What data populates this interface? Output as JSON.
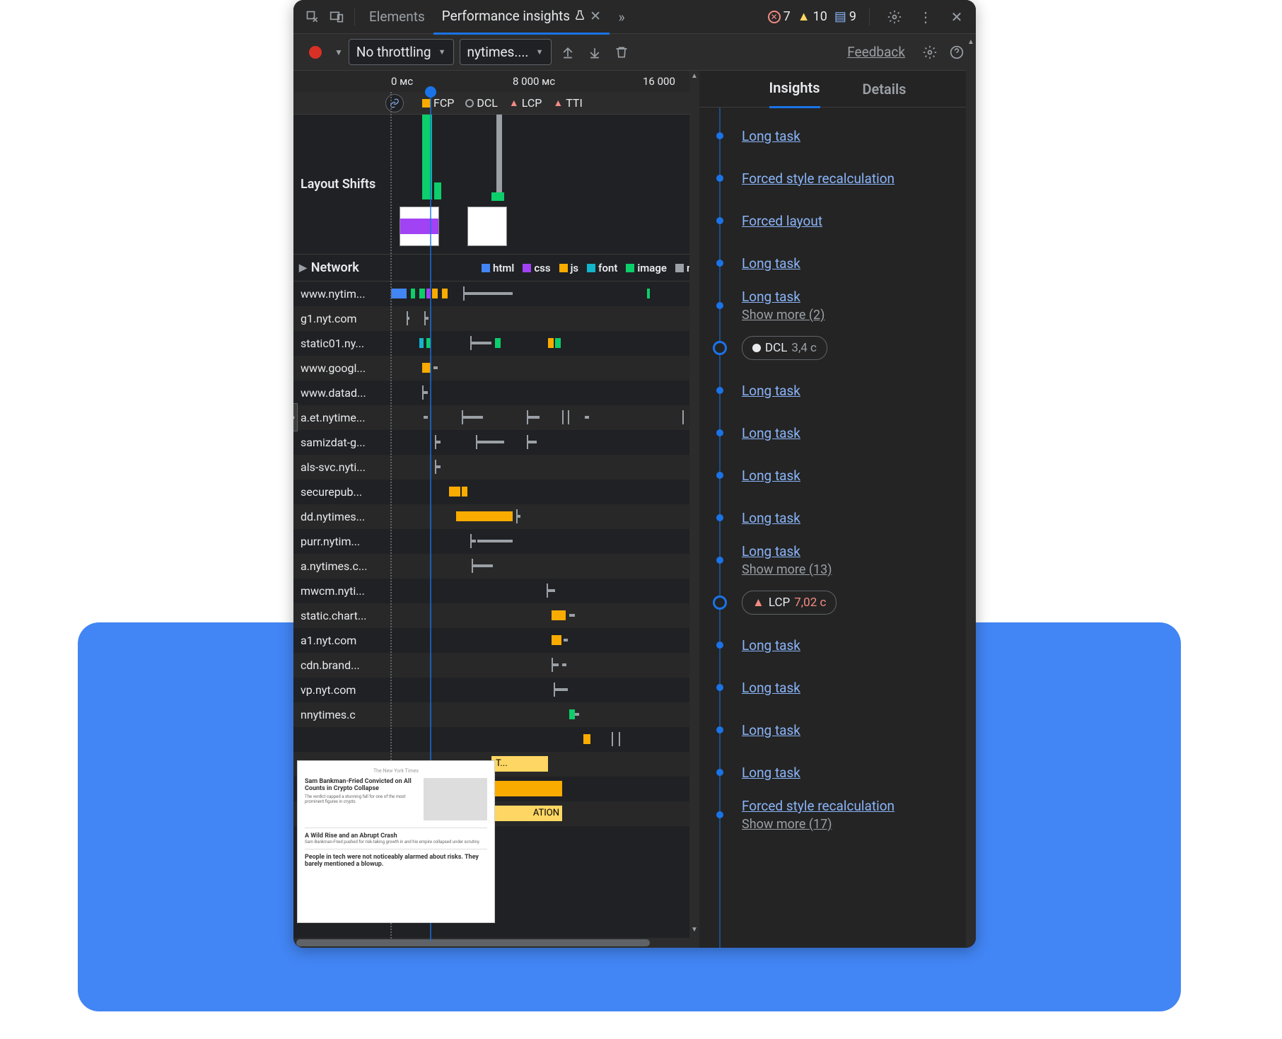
{
  "toolbar": {
    "tabs": {
      "elements": "Elements",
      "perf_insights": "Performance insights"
    },
    "status": {
      "errors": "7",
      "warnings": "10",
      "messages": "9"
    }
  },
  "action_bar": {
    "throttling": "No throttling",
    "target": "nytimes....",
    "feedback": "Feedback"
  },
  "timeline": {
    "ticks": {
      "t0": "0 мс",
      "t8000": "8 000 мс",
      "t16000": "16 000"
    },
    "metrics": {
      "fcp": "FCP",
      "dcl": "DCL",
      "lcp": "LCP",
      "tti": "TTI"
    }
  },
  "layout_shifts": {
    "label": "Layout Shifts"
  },
  "network": {
    "header": "Network",
    "legend": {
      "html": "html",
      "css": "css",
      "js": "js",
      "font": "font",
      "image": "image",
      "m": "m"
    },
    "colors": {
      "html": "#4285f4",
      "css": "#a142f4",
      "js": "#f9ab00",
      "font": "#12b5cb",
      "image": "#0cce6b"
    },
    "rows": [
      "www.nytim...",
      "g1.nyt.com",
      "static01.ny...",
      "www.googl...",
      "www.datad...",
      "a.et.nytime...",
      "samizdat-g...",
      "als-svc.nyti...",
      "securepub...",
      "dd.nytimes...",
      "purr.nytim...",
      "a.nytimes.c...",
      "mwcm.nyti...",
      "static.chart...",
      "a1.nyt.com",
      "cdn.brand...",
      "vp.nyt.com",
      "nnytimes.c"
    ]
  },
  "right_pane": {
    "tabs": {
      "insights": "Insights",
      "details": "Details"
    },
    "items": [
      {
        "type": "link",
        "label": "Long task"
      },
      {
        "type": "link",
        "label": "Forced style recalculation"
      },
      {
        "type": "link",
        "label": "Forced layout"
      },
      {
        "type": "link",
        "label": "Long task"
      },
      {
        "type": "link_more",
        "label": "Long task",
        "more": "Show more (2)"
      },
      {
        "type": "pill",
        "marker": "dcl",
        "label": "DCL",
        "value": "3,4 c"
      },
      {
        "type": "link",
        "label": "Long task"
      },
      {
        "type": "link",
        "label": "Long task"
      },
      {
        "type": "link",
        "label": "Long task"
      },
      {
        "type": "link",
        "label": "Long task"
      },
      {
        "type": "link_more",
        "label": "Long task",
        "more": "Show more (13)"
      },
      {
        "type": "pill",
        "marker": "lcp",
        "label": "LCP",
        "value": "7,02 c"
      },
      {
        "type": "link",
        "label": "Long task"
      },
      {
        "type": "link",
        "label": "Long task"
      },
      {
        "type": "link",
        "label": "Long task"
      },
      {
        "type": "link",
        "label": "Long task"
      },
      {
        "type": "link_more",
        "label": "Forced style recalculation",
        "more": "Show more (17)"
      }
    ]
  },
  "thumb_preview": {
    "title": "The New York Times",
    "headline1": "Sam Bankman-Fried Convicted on All Counts in Crypto Collapse",
    "headline2": "A Wild Rise and an Abrupt Crash",
    "headline3": "People in tech were not noticeably alarmed about risks. They barely mentioned a blowup."
  }
}
